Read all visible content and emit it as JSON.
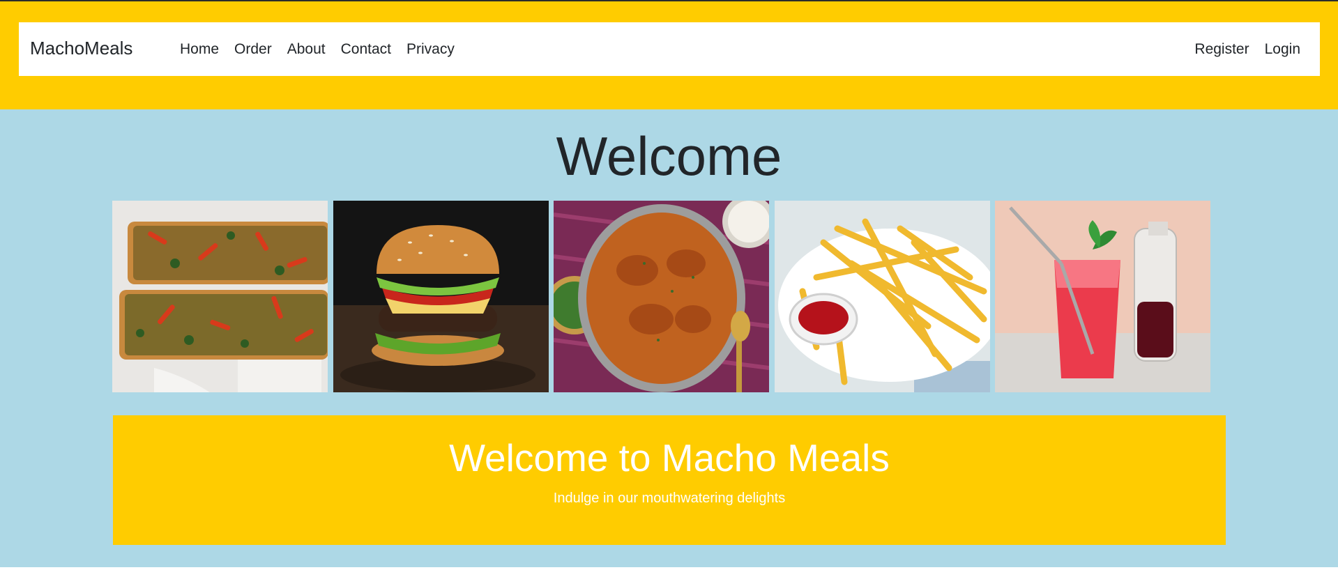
{
  "navbar": {
    "brand": "MachoMeals",
    "left_links": [
      {
        "label": "Home"
      },
      {
        "label": "Order"
      },
      {
        "label": "About"
      },
      {
        "label": "Contact"
      },
      {
        "label": "Privacy"
      }
    ],
    "right_links": [
      {
        "label": "Register"
      },
      {
        "label": "Login"
      }
    ]
  },
  "main": {
    "welcome_heading": "Welcome",
    "gallery": [
      {
        "icon": "pizza-image"
      },
      {
        "icon": "burger-image"
      },
      {
        "icon": "curry-image"
      },
      {
        "icon": "fries-image"
      },
      {
        "icon": "drink-image"
      }
    ]
  },
  "promo": {
    "title": "Welcome to Macho Meals",
    "subtitle": "Indulge in our mouthwatering delights"
  },
  "colors": {
    "header_band": "#ffcc00",
    "page_background": "#add8e6",
    "promo_background": "#ffcc00",
    "text_dark": "#212529",
    "promo_text": "#ffffff"
  }
}
